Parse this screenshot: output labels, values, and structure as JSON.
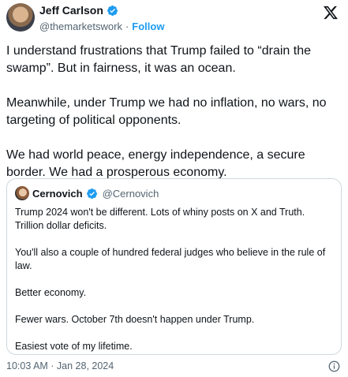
{
  "tweet": {
    "author": {
      "name": "Jeff Carlson",
      "handle": "@themarketswork",
      "separator": "·",
      "follow_label": "Follow",
      "verified": true
    },
    "paragraphs": [
      "I understand frustrations that Trump failed to “drain the swamp”. But in fairness, it was an ocean.",
      "Meanwhile, under Trump we had no inflation, no wars, no targeting of political opponents.",
      "We had world peace, energy independence, a secure border. We had a prosperous economy."
    ],
    "quote": {
      "author": {
        "name": "Cernovich",
        "handle": "@Cernovich",
        "verified": true
      },
      "paragraphs": [
        "Trump 2024 won't be different. Lots of whiny posts on X and Truth. Trillion dollar deficits.",
        "You'll also a couple of hundred federal judges who believe in the rule of law.",
        "Better economy.",
        "Fewer wars. October 7th doesn't happen under Trump.",
        "Easiest vote of my lifetime."
      ]
    },
    "timestamp": "10:03 AM · Jan 28, 2024"
  },
  "icons": {
    "verified": "verified-badge-icon",
    "platform": "x-logo-icon",
    "info": "info-icon"
  },
  "colors": {
    "accent": "#1d9bf0",
    "text": "#0f1419",
    "secondary": "#536471",
    "border": "#cfd9de"
  }
}
